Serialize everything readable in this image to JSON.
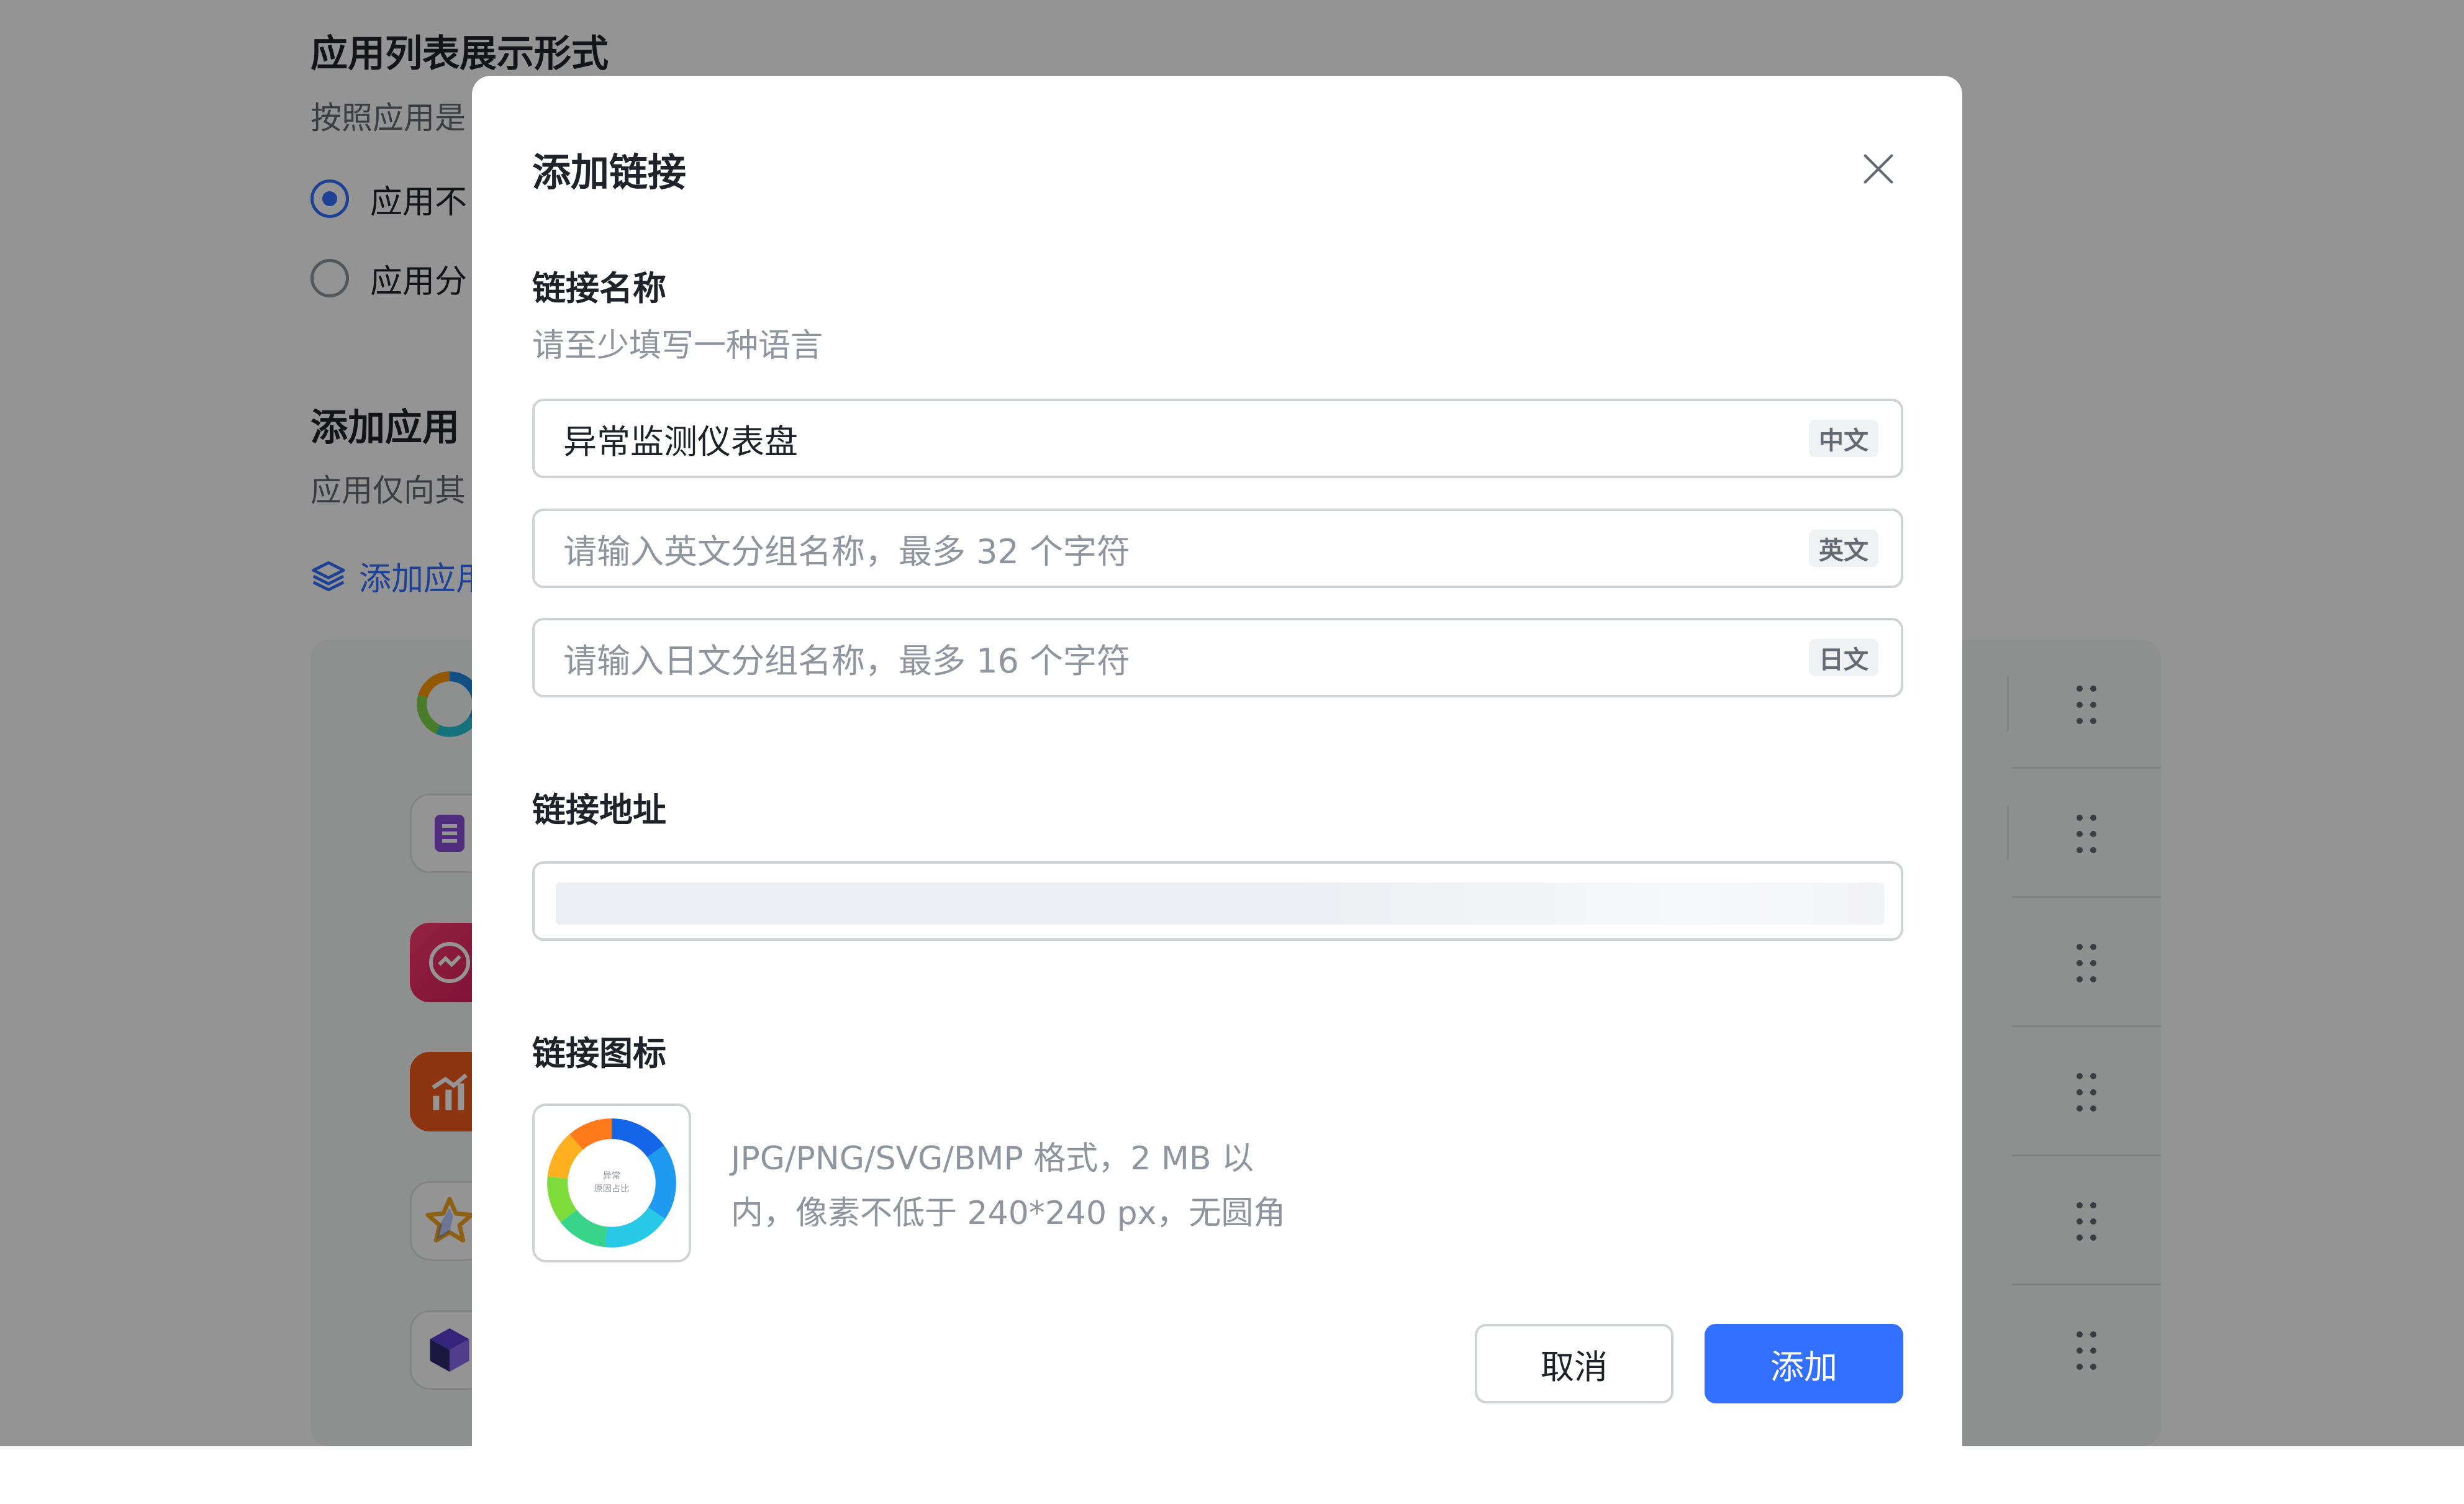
{
  "background": {
    "display_section": {
      "title": "应用列表展示形式",
      "desc": "按照应用是",
      "options": [
        {
          "label": "应用不",
          "selected": true
        },
        {
          "label": "应用分",
          "selected": false
        }
      ]
    },
    "apps_section": {
      "title": "添加应用",
      "desc": "应用仅向其",
      "add_link_label": "添加应用"
    },
    "app_icons": [
      "donut-chart-icon",
      "document-icon",
      "gauge-icon",
      "bar-chart-icon",
      "star-icon",
      "cube-icon"
    ]
  },
  "modal": {
    "title": "添加链接",
    "name_section": {
      "label": "链接名称",
      "hint": "请至少填写一种语言",
      "inputs": [
        {
          "value": "异常监测仪表盘",
          "placeholder": "",
          "tag": "中文"
        },
        {
          "value": "",
          "placeholder": "请输入英文分组名称，最多 32 个字符",
          "tag": "英文"
        },
        {
          "value": "",
          "placeholder": "请输入日文分组名称，最多 16 个字符",
          "tag": "日文"
        }
      ]
    },
    "url_section": {
      "label": "链接地址"
    },
    "icon_section": {
      "label": "链接图标",
      "icon_text_line1": "异常",
      "icon_text_line2": "原因占比",
      "help_line1": "JPG/PNG/SVG/BMP 格式，2 MB 以",
      "help_line2": "内，像素不低于 240*240 px，无圆角"
    },
    "buttons": {
      "cancel": "取消",
      "add": "添加"
    },
    "colors": {
      "primary": "#3370ff",
      "border": "#d0d3d6",
      "text": "#1f2329",
      "hint": "#8f959e"
    }
  }
}
